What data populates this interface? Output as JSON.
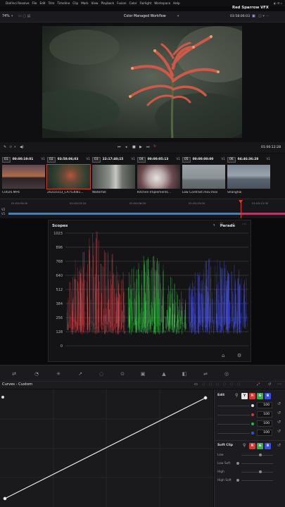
{
  "menubar": {
    "apple": "",
    "items": [
      "DaVinci Resolve",
      "File",
      "Edit",
      "Trim",
      "Timeline",
      "Clip",
      "Mark",
      "View",
      "Playback",
      "Fusion",
      "Color",
      "Fairlight",
      "Workspace",
      "Help"
    ]
  },
  "brand": "Red Sparrow VFX",
  "toolbar": {
    "zoom": "74%",
    "title": "Color Managed Workflow",
    "timecode": "03:58:06:03"
  },
  "viewer": {
    "timecode": "01:00:12:28"
  },
  "clips": [
    {
      "num": "01",
      "tc": "00:00:19:01",
      "track": "V1",
      "name": "C0026.MP4"
    },
    {
      "num": "02",
      "tc": "03:58:06;03",
      "track": "V1",
      "name": "20210313_CA753081...",
      "selected": true
    },
    {
      "num": "03",
      "tc": "22:17:40;15",
      "track": "V1",
      "name": "Waterfall"
    },
    {
      "num": "04",
      "tc": "00:00:05:13",
      "track": "V1",
      "name": "Kitchen Implements..."
    },
    {
      "num": "05",
      "tc": "00:00:00:00",
      "track": "V1",
      "name": "Low Contrast.mov.mov"
    },
    {
      "num": "06",
      "tc": "04:46:36:28",
      "track": "V1",
      "name": "Shanghai"
    }
  ],
  "timeline": {
    "ticks": [
      "01:00:00:00",
      "01:00:03:10",
      "01:00:06:20",
      "01:00:10:00",
      "01:00:13:30"
    ],
    "tracks": [
      "V2",
      "V1"
    ],
    "playhead_fraction": 0.843
  },
  "scopes": {
    "title": "Scopes",
    "mode": "Parade",
    "y_ticks": [
      "1023",
      "896",
      "768",
      "640",
      "512",
      "384",
      "256",
      "128",
      "0"
    ],
    "channel_colors": [
      "#e2474c",
      "#3bd14a",
      "#4b55f0"
    ]
  },
  "curves": {
    "title": "Curves - Custom"
  },
  "edit": {
    "label": "Edit",
    "channels": [
      {
        "chip": "Y",
        "value": "100",
        "color": "#e6e6e6"
      },
      {
        "chip": "R",
        "value": "100",
        "color": "#d93636"
      },
      {
        "chip": "G",
        "value": "100",
        "color": "#2fb34a"
      },
      {
        "chip": "B",
        "value": "100",
        "color": "#3a4ee0"
      }
    ]
  },
  "soft_clip": {
    "label": "Soft Clip",
    "items": [
      "Low",
      "Low Soft",
      "High",
      "High Soft"
    ]
  }
}
